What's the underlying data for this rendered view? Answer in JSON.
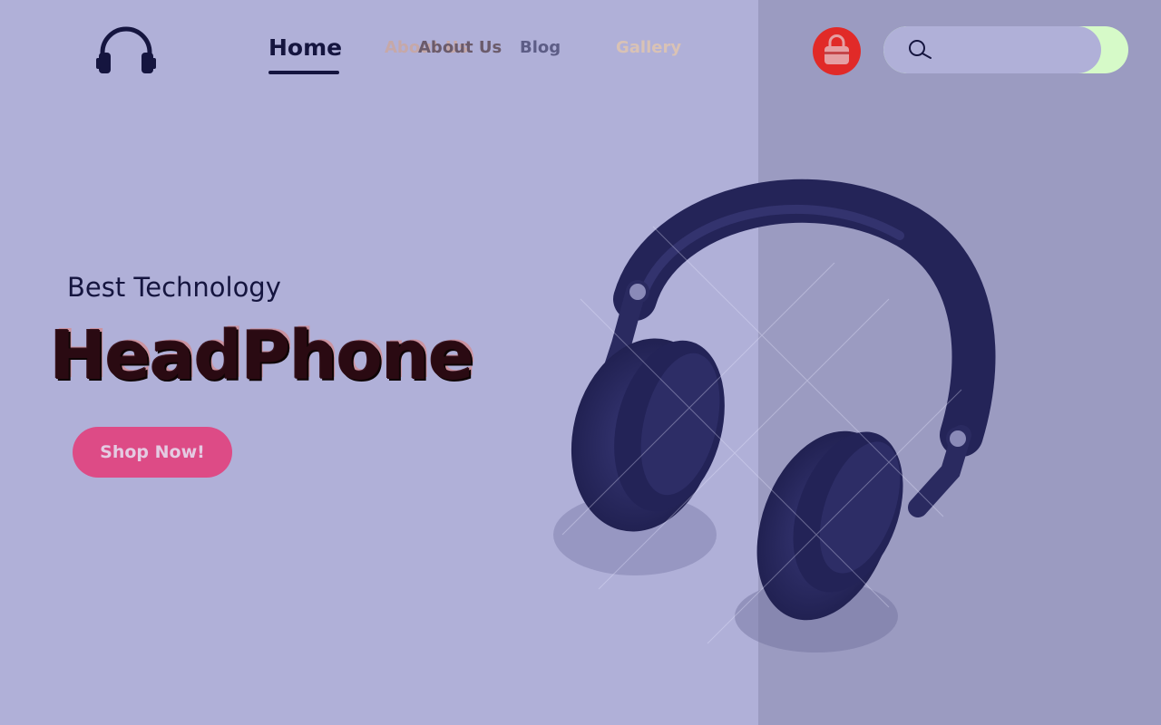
{
  "nav": {
    "home": "Home",
    "about_ghost": "About Us",
    "about": "About Us",
    "blog": "Blog",
    "gallery": "Gallery"
  },
  "search": {
    "placeholder": "",
    "value": ""
  },
  "hero": {
    "subtitle": "Best Technology",
    "title": "HeadPhone",
    "title_shadow": "HeadPhone",
    "cta": "Shop Now!"
  },
  "icons": {
    "logo": "headphones-icon",
    "cart": "shopping-bag-icon",
    "search": "search-icon"
  },
  "colors": {
    "background": "#b0b0d8",
    "panel": "#9b9bc1",
    "accent_red": "#e12a28",
    "cta_pink": "#dd4b86",
    "dark_text": "#15153f",
    "search_accent": "#d6fac8"
  }
}
